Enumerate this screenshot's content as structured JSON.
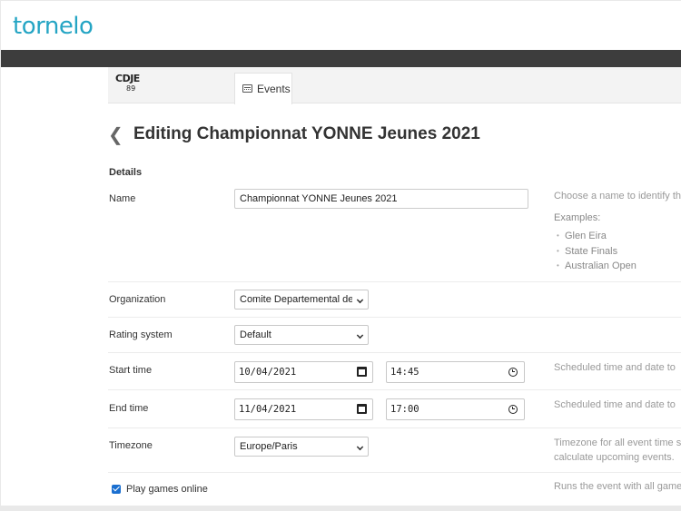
{
  "app": {
    "logo_text": "tornelo"
  },
  "org": {
    "logo_line1": "CDJE",
    "logo_line2": "89"
  },
  "tabs": [
    {
      "label": "Events"
    }
  ],
  "page": {
    "back_glyph": "❮",
    "title": "Editing Championnat YONNE Jeunes 2021"
  },
  "details": {
    "section_title": "Details",
    "name": {
      "label": "Name",
      "value": "Championnat YONNE Jeunes 2021",
      "help": "Choose a name to identify th",
      "examples_title": "Examples:",
      "examples": [
        "Glen Eira",
        "State Finals",
        "Australian Open"
      ]
    },
    "organization": {
      "label": "Organization",
      "value": "Comite Departemental de"
    },
    "rating_system": {
      "label": "Rating system",
      "value": "Default"
    },
    "start_time": {
      "label": "Start time",
      "date": "10/04/2021",
      "time": "14:45",
      "help": "Scheduled time and date to"
    },
    "end_time": {
      "label": "End time",
      "date": "11/04/2021",
      "time": "17:00",
      "help": "Scheduled time and date to"
    },
    "timezone": {
      "label": "Timezone",
      "value": "Europe/Paris",
      "help_line1": "Timezone for all event time s",
      "help_line2": "calculate upcoming events."
    },
    "play_online": {
      "label": "Play games online",
      "checked": true,
      "help": "Runs the event with all game"
    }
  },
  "colors": {
    "brand": "#25a5c4",
    "header_dark": "#3d3d3d",
    "checkbox": "#1a6fd0"
  },
  "icons": [
    "calendar-icon",
    "clock-icon",
    "back-chevron-icon",
    "events-tab-icon",
    "dropdown-caret-icon",
    "checkbox-check-icon"
  ]
}
